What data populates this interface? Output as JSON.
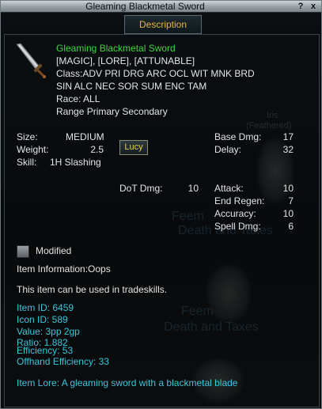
{
  "window": {
    "title": "Gleaming Blackmetal Sword",
    "help_label": "?",
    "close_label": "x",
    "tab_label": "Description"
  },
  "background": {
    "name1": "Iris",
    "name1_sub": "(Feathered)",
    "name2": "Feem",
    "name2_sub": "Death and Taxes"
  },
  "item": {
    "name": "Gleaming Blackmetal Sword",
    "flags": "[MAGIC], [LORE], [ATTUNABLE]",
    "class_line1": "Class:ADV PRI DRG ARC OCL WIT MNK BRD",
    "class_line2": "SIN ALC NEC SOR SUM ENC TAM",
    "race": "Race:  ALL",
    "range": "Range Primary Secondary"
  },
  "stats_left": {
    "size_label": "Size:",
    "size_value": "MEDIUM",
    "weight_label": "Weight:",
    "weight_value": "2.5",
    "skill_label": "Skill:",
    "skill_value": "1H Slashing"
  },
  "lucy_button": "Lucy",
  "stats_right": {
    "base_dmg_label": "Base Dmg:",
    "base_dmg_value": "17",
    "delay_label": "Delay:",
    "delay_value": "32",
    "attack_label": "Attack:",
    "attack_value": "10",
    "end_regen_label": "End Regen:",
    "end_regen_value": "7",
    "accuracy_label": "Accuracy:",
    "accuracy_value": "10",
    "spell_dmg_label": "Spell Dmg:",
    "spell_dmg_value": "6"
  },
  "dot": {
    "label": "DoT Dmg:",
    "value": "10"
  },
  "modified_label": "Modified",
  "item_information": "Item Information:Oops",
  "tradeskills": "This item can be used in tradeskills.",
  "details": {
    "item_id": "Item ID: 6459",
    "icon_id": "Icon ID: 589",
    "value": "Value: 3pp 2gp",
    "ratio": "Ratio: 1.882",
    "efficiency": "Efficiency: 53",
    "offhand_efficiency": "Offhand Efficiency: 33"
  },
  "lore": "Item Lore: A gleaming sword with a blackmetal blade",
  "colors": {
    "title_text": "#111111",
    "tab_text": "#e6b43c",
    "item_name": "#3fd63f",
    "details": "#38c8dc"
  }
}
